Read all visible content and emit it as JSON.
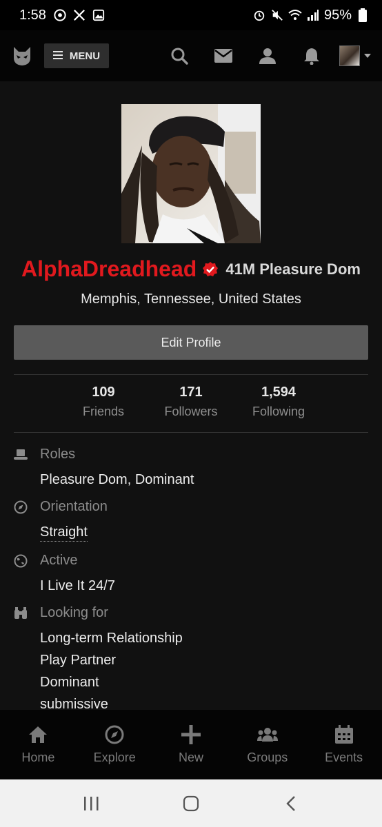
{
  "status_bar": {
    "time": "1:58",
    "battery": "95%",
    "left_icons": [
      "chrome-icon",
      "x-icon",
      "gallery-icon"
    ],
    "right_icons": [
      "alarm-icon",
      "mute-icon",
      "wifi-icon",
      "signal-icon",
      "battery-icon"
    ]
  },
  "nav": {
    "menu_label": "MENU",
    "icons": [
      "search-icon",
      "mail-icon",
      "user-icon",
      "bell-icon"
    ]
  },
  "profile": {
    "username": "AlphaDreadhead",
    "meta": "41M Pleasure Dom",
    "location": "Memphis, Tennessee, United States",
    "edit_label": "Edit Profile",
    "colors": {
      "username": "#e1191e",
      "verified": "#e1191e"
    }
  },
  "stats": [
    {
      "value": "109",
      "label": "Friends"
    },
    {
      "value": "171",
      "label": "Followers"
    },
    {
      "value": "1,594",
      "label": "Following"
    }
  ],
  "details": {
    "roles": {
      "title": "Roles",
      "value": "Pleasure Dom, Dominant",
      "icon": "hat-icon"
    },
    "orientation": {
      "title": "Orientation",
      "value": "Straight",
      "icon": "compass-icon"
    },
    "active": {
      "title": "Active",
      "value": "I Live It 24/7",
      "icon": "globe-icon"
    },
    "looking_for": {
      "title": "Looking for",
      "icon": "binoculars-icon",
      "values": [
        "Long-term Relationship",
        "Play Partner",
        "Dominant",
        "submissive"
      ]
    }
  },
  "tabs": [
    {
      "label": "Home",
      "icon": "home-icon"
    },
    {
      "label": "Explore",
      "icon": "compass-icon"
    },
    {
      "label": "New",
      "icon": "plus-icon"
    },
    {
      "label": "Groups",
      "icon": "groups-icon"
    },
    {
      "label": "Events",
      "icon": "calendar-icon"
    }
  ],
  "android_nav": [
    "recents-button",
    "home-button",
    "back-button"
  ]
}
